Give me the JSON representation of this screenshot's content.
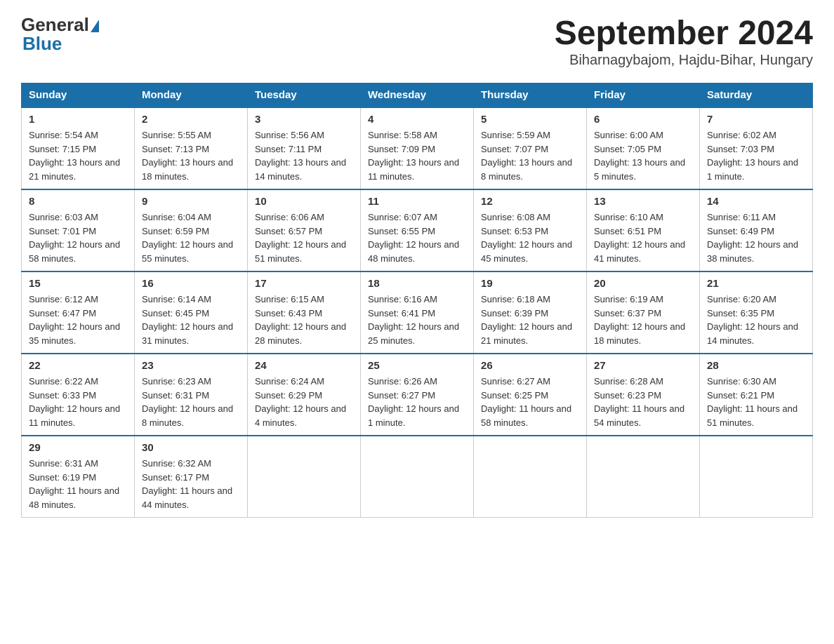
{
  "header": {
    "logo_general": "General",
    "logo_blue": "Blue",
    "month_title": "September 2024",
    "location": "Biharnagybajom, Hajdu-Bihar, Hungary"
  },
  "days_of_week": [
    "Sunday",
    "Monday",
    "Tuesday",
    "Wednesday",
    "Thursday",
    "Friday",
    "Saturday"
  ],
  "weeks": [
    [
      {
        "day": "1",
        "sunrise": "5:54 AM",
        "sunset": "7:15 PM",
        "daylight": "13 hours and 21 minutes."
      },
      {
        "day": "2",
        "sunrise": "5:55 AM",
        "sunset": "7:13 PM",
        "daylight": "13 hours and 18 minutes."
      },
      {
        "day": "3",
        "sunrise": "5:56 AM",
        "sunset": "7:11 PM",
        "daylight": "13 hours and 14 minutes."
      },
      {
        "day": "4",
        "sunrise": "5:58 AM",
        "sunset": "7:09 PM",
        "daylight": "13 hours and 11 minutes."
      },
      {
        "day": "5",
        "sunrise": "5:59 AM",
        "sunset": "7:07 PM",
        "daylight": "13 hours and 8 minutes."
      },
      {
        "day": "6",
        "sunrise": "6:00 AM",
        "sunset": "7:05 PM",
        "daylight": "13 hours and 5 minutes."
      },
      {
        "day": "7",
        "sunrise": "6:02 AM",
        "sunset": "7:03 PM",
        "daylight": "13 hours and 1 minute."
      }
    ],
    [
      {
        "day": "8",
        "sunrise": "6:03 AM",
        "sunset": "7:01 PM",
        "daylight": "12 hours and 58 minutes."
      },
      {
        "day": "9",
        "sunrise": "6:04 AM",
        "sunset": "6:59 PM",
        "daylight": "12 hours and 55 minutes."
      },
      {
        "day": "10",
        "sunrise": "6:06 AM",
        "sunset": "6:57 PM",
        "daylight": "12 hours and 51 minutes."
      },
      {
        "day": "11",
        "sunrise": "6:07 AM",
        "sunset": "6:55 PM",
        "daylight": "12 hours and 48 minutes."
      },
      {
        "day": "12",
        "sunrise": "6:08 AM",
        "sunset": "6:53 PM",
        "daylight": "12 hours and 45 minutes."
      },
      {
        "day": "13",
        "sunrise": "6:10 AM",
        "sunset": "6:51 PM",
        "daylight": "12 hours and 41 minutes."
      },
      {
        "day": "14",
        "sunrise": "6:11 AM",
        "sunset": "6:49 PM",
        "daylight": "12 hours and 38 minutes."
      }
    ],
    [
      {
        "day": "15",
        "sunrise": "6:12 AM",
        "sunset": "6:47 PM",
        "daylight": "12 hours and 35 minutes."
      },
      {
        "day": "16",
        "sunrise": "6:14 AM",
        "sunset": "6:45 PM",
        "daylight": "12 hours and 31 minutes."
      },
      {
        "day": "17",
        "sunrise": "6:15 AM",
        "sunset": "6:43 PM",
        "daylight": "12 hours and 28 minutes."
      },
      {
        "day": "18",
        "sunrise": "6:16 AM",
        "sunset": "6:41 PM",
        "daylight": "12 hours and 25 minutes."
      },
      {
        "day": "19",
        "sunrise": "6:18 AM",
        "sunset": "6:39 PM",
        "daylight": "12 hours and 21 minutes."
      },
      {
        "day": "20",
        "sunrise": "6:19 AM",
        "sunset": "6:37 PM",
        "daylight": "12 hours and 18 minutes."
      },
      {
        "day": "21",
        "sunrise": "6:20 AM",
        "sunset": "6:35 PM",
        "daylight": "12 hours and 14 minutes."
      }
    ],
    [
      {
        "day": "22",
        "sunrise": "6:22 AM",
        "sunset": "6:33 PM",
        "daylight": "12 hours and 11 minutes."
      },
      {
        "day": "23",
        "sunrise": "6:23 AM",
        "sunset": "6:31 PM",
        "daylight": "12 hours and 8 minutes."
      },
      {
        "day": "24",
        "sunrise": "6:24 AM",
        "sunset": "6:29 PM",
        "daylight": "12 hours and 4 minutes."
      },
      {
        "day": "25",
        "sunrise": "6:26 AM",
        "sunset": "6:27 PM",
        "daylight": "12 hours and 1 minute."
      },
      {
        "day": "26",
        "sunrise": "6:27 AM",
        "sunset": "6:25 PM",
        "daylight": "11 hours and 58 minutes."
      },
      {
        "day": "27",
        "sunrise": "6:28 AM",
        "sunset": "6:23 PM",
        "daylight": "11 hours and 54 minutes."
      },
      {
        "day": "28",
        "sunrise": "6:30 AM",
        "sunset": "6:21 PM",
        "daylight": "11 hours and 51 minutes."
      }
    ],
    [
      {
        "day": "29",
        "sunrise": "6:31 AM",
        "sunset": "6:19 PM",
        "daylight": "11 hours and 48 minutes."
      },
      {
        "day": "30",
        "sunrise": "6:32 AM",
        "sunset": "6:17 PM",
        "daylight": "11 hours and 44 minutes."
      },
      null,
      null,
      null,
      null,
      null
    ]
  ]
}
